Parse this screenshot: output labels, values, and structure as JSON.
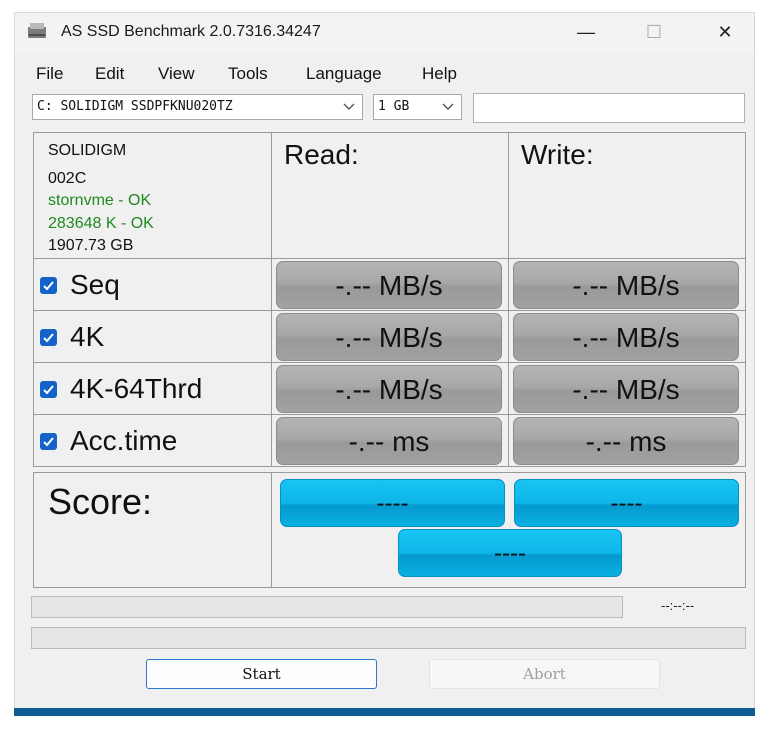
{
  "window": {
    "title": "AS SSD Benchmark 2.0.7316.34247"
  },
  "titlebar_buttons": {
    "minimize": "—",
    "maximize": "☐",
    "close": "✕"
  },
  "menu": [
    "File",
    "Edit",
    "View",
    "Tools",
    "Language",
    "Help"
  ],
  "drive_select": {
    "value": "C: SOLIDIGM SSDPFKNU020TZ"
  },
  "size_select": {
    "value": "1 GB"
  },
  "drive_info": {
    "model": "SOLIDIGM",
    "firmware": "002C",
    "driver": "stornvme - OK",
    "alignment": "283648 K - OK",
    "capacity": "1907.73 GB"
  },
  "columns": {
    "read": "Read:",
    "write": "Write:"
  },
  "tests": [
    {
      "label": "Seq",
      "checked": true,
      "read": "-.-- MB/s",
      "write": "-.-- MB/s"
    },
    {
      "label": "4K",
      "checked": true,
      "read": "-.-- MB/s",
      "write": "-.-- MB/s"
    },
    {
      "label": "4K-64Thrd",
      "checked": true,
      "read": "-.-- MB/s",
      "write": "-.-- MB/s"
    },
    {
      "label": "Acc.time",
      "checked": true,
      "read": "-.-- ms",
      "write": "-.-- ms"
    }
  ],
  "score": {
    "label": "Score:",
    "read": "----",
    "write": "----",
    "total": "----"
  },
  "progress": {
    "time": "--:--:--",
    "value": 0
  },
  "buttons": {
    "start": "Start",
    "abort": "Abort"
  },
  "colors": {
    "accent": "#1463c9",
    "score": "#0fb6e8",
    "ok_text": "#1f8a1f",
    "result_gray": "#a8a8a8"
  }
}
